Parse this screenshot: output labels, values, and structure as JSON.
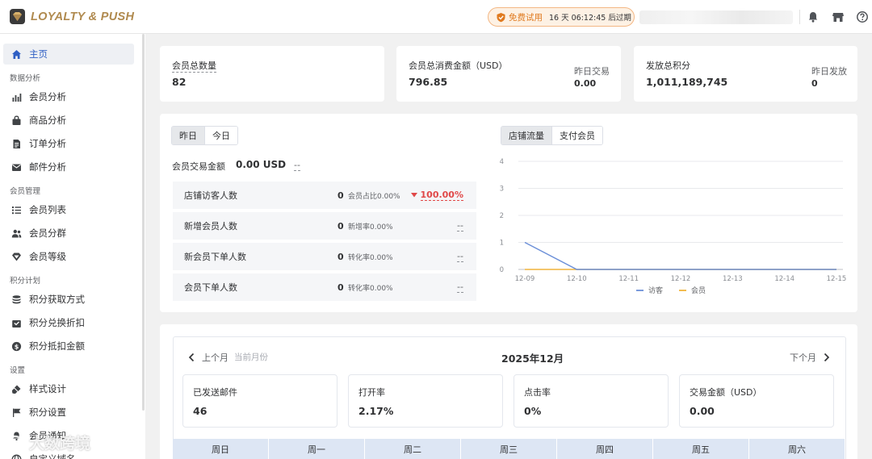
{
  "app": {
    "logo_text": "LOYALTY & PUSH",
    "trial_label": "免费试用",
    "trial_countdown": "16 天 06:12:45 后过期"
  },
  "icons": {
    "bell": "bell-icon",
    "store": "store-icon",
    "help": "help-icon"
  },
  "sidebar": {
    "home": "主页",
    "group_data": "数据分析",
    "member_analysis": "会员分析",
    "product_analysis": "商品分析",
    "order_analysis": "订单分析",
    "email_analysis": "邮件分析",
    "group_member": "会员管理",
    "member_list": "会员列表",
    "member_group": "会员分群",
    "member_level": "会员等级",
    "group_points": "积分计划",
    "points_earn": "积分获取方式",
    "points_redeem": "积分兑换折扣",
    "points_deduct": "积分抵扣金额",
    "group_settings": "设置",
    "style_design": "样式设计",
    "points_settings": "积分设置",
    "member_notify": "会员通知",
    "custom_domain": "自定义域名"
  },
  "stats": {
    "total_members_label": "会员总数量",
    "total_members_value": "82",
    "total_spend_label": "会员总消费金额（USD）",
    "total_spend_value": "796.85",
    "yesterday_trade_label": "昨日交易",
    "yesterday_trade_value": "0.00",
    "total_points_label": "发放总积分",
    "total_points_value": "1,011,189,745",
    "yesterday_issue_label": "昨日发放",
    "yesterday_issue_value": "0"
  },
  "overview": {
    "tab_yesterday": "昨日",
    "tab_today": "今日",
    "trade_label": "会员交易金额",
    "trade_value": "0.00 USD",
    "trade_trend": "--",
    "rows": [
      {
        "label": "店铺访客人数",
        "num": "0",
        "rate": "会员占比0.00%",
        "trend": "100.00%"
      },
      {
        "label": "新增会员人数",
        "num": "0",
        "rate": "新增率0.00%",
        "trend": "--"
      },
      {
        "label": "新会员下单人数",
        "num": "0",
        "rate": "转化率0.00%",
        "trend": "--"
      },
      {
        "label": "会员下单人数",
        "num": "0",
        "rate": "转化率0.00%",
        "trend": "--"
      }
    ],
    "chart_tab_traffic": "店铺流量",
    "chart_tab_paid": "支付会员"
  },
  "chart_data": {
    "type": "line",
    "x": [
      "12-09",
      "12-10",
      "12-11",
      "12-12",
      "12-13",
      "12-14",
      "12-15"
    ],
    "ylim": [
      0,
      4
    ],
    "yticks": [
      "0",
      "1",
      "2",
      "3",
      "4"
    ],
    "series": [
      {
        "name": "访客",
        "values": [
          1,
          0,
          0,
          0,
          0,
          0,
          0
        ],
        "color": "#6b8fd8"
      },
      {
        "name": "会员",
        "values": [
          0,
          0,
          0,
          0,
          0,
          0,
          0
        ],
        "color": "#f0b43c"
      }
    ],
    "grid": true,
    "legend": "bottom"
  },
  "calendar": {
    "prev_month": "上个月",
    "current_month": "当前月份",
    "title": "2025年12月",
    "next_month": "下个月",
    "kpis": [
      {
        "label": "已发送邮件",
        "value": "46"
      },
      {
        "label": "打开率",
        "value": "2.17%"
      },
      {
        "label": "点击率",
        "value": "0%"
      },
      {
        "label": "交易金额（USD）",
        "value": "0.00"
      }
    ],
    "weekdays": [
      "周日",
      "周一",
      "周二",
      "周三",
      "周四",
      "周五",
      "周六"
    ]
  },
  "watermark": "大数跨境",
  "colors": {
    "accent": "#2f5fc4",
    "brand_gold": "#b08a4f",
    "trial_orange": "#e07a1f",
    "down_red": "#e04848"
  }
}
